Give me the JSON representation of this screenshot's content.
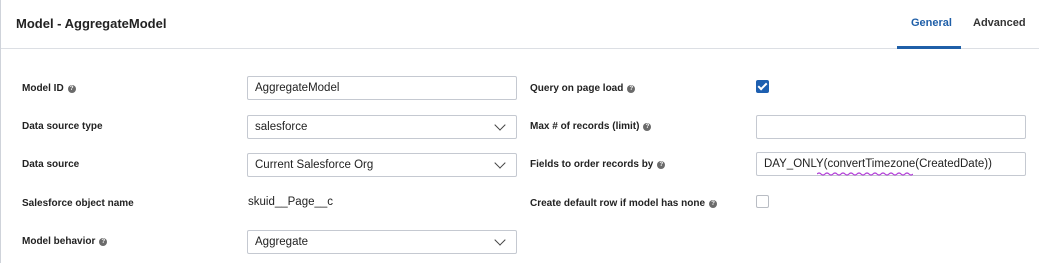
{
  "header": {
    "title": "Model - AggregateModel",
    "tabs": [
      {
        "label": "General",
        "active": true
      },
      {
        "label": "Advanced",
        "active": false
      }
    ]
  },
  "left": {
    "model_id": {
      "label": "Model ID",
      "value": "AggregateModel"
    },
    "data_source_type": {
      "label": "Data source type",
      "value": "salesforce"
    },
    "data_source": {
      "label": "Data source",
      "value": "Current Salesforce Org"
    },
    "object_name": {
      "label": "Salesforce object name",
      "value": "skuid__Page__c"
    },
    "model_behavior": {
      "label": "Model behavior",
      "value": "Aggregate"
    }
  },
  "right": {
    "query_on_load": {
      "label": "Query on page load",
      "checked": true
    },
    "max_records": {
      "label": "Max # of records (limit)",
      "value": ""
    },
    "order_by": {
      "label": "Fields to order records by",
      "value": "DAY_ONLY(convertTimezone(CreatedDate))"
    },
    "default_row": {
      "label": "Create default row if model has none",
      "checked": false
    }
  },
  "colors": {
    "accent": "#1f5fa8",
    "checkbox": "#1d5fb0",
    "squiggle": "#b03ad6"
  },
  "icons": {
    "help": "question-circle-icon",
    "dropdown": "chevron-down-icon",
    "check": "checkmark-icon"
  }
}
